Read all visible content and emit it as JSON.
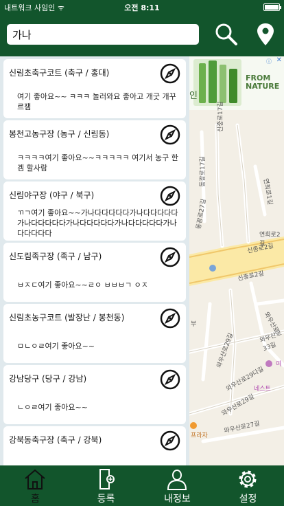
{
  "status_bar": {
    "carrier": "내트워크 사임인 ᯤ",
    "time": "오전 8:11"
  },
  "search": {
    "value": "가나",
    "placeholder": ""
  },
  "cards": [
    {
      "title": "신림초축구코트 (축구 / 홍대)",
      "body": "여기 좋아요~~ ㅋㅋㅋ 놀러와요 좋아고 개굿 개꾸르잼"
    },
    {
      "title": "봉천고농구장 (농구 / 신림동)",
      "body": "ㅋㅋㅋㅋ여기 좋아요~~ㅋㅋㅋㅋㅋ 여기서 농구 한겜 할사람"
    },
    {
      "title": "신림야구장 (야구 / 북구)",
      "body": "ㄲㄱ여기 좋아요~~가나다다다다다가나다다다다다가나다다다다다가나다다다다다가나다다다다다가나다다다다다"
    },
    {
      "title": "신도림족구장 (족구 / 남구)",
      "body": "ㅂㅈㄷ여기 좋아요~~ㄹㅇ ㅂㅂㅂㄱ ㅇㅈ"
    },
    {
      "title": "신림초농구코트 (발장난 / 봉천동)",
      "body": "ㅁㄴㅇㄹ여기 좋아요~~"
    },
    {
      "title": "강남당구 (당구 / 강남)",
      "body": "ㄴㅇㄹ여기 좋아요~~"
    },
    {
      "title": "강북동축구장 (축구 / 강북)",
      "body": ""
    }
  ],
  "map": {
    "ad_brand": "FROM NATURE",
    "ad_side_text": "인",
    "road_labels": [
      "신중로17길",
      "신종로2길",
      "신종로2길",
      "동광로17길",
      "와우산로29길",
      "와우산로",
      "와우산로29길",
      "와우산로29다길",
      "와우산로27길",
      "네스트 ",
      "프라자",
      "부",
      "연희로1길",
      "연희로2길",
      "동광로27길",
      "와우산로33길",
      "여"
    ]
  },
  "tabs": [
    {
      "label": "홈",
      "icon": "home-icon"
    },
    {
      "label": "등록",
      "icon": "add-document-icon"
    },
    {
      "label": "내정보",
      "icon": "profile-icon"
    },
    {
      "label": "설정",
      "icon": "gear-icon"
    }
  ],
  "colors": {
    "primary": "#12552c",
    "list_bg": "#e0e9ed",
    "card_bg": "#ffffff"
  }
}
